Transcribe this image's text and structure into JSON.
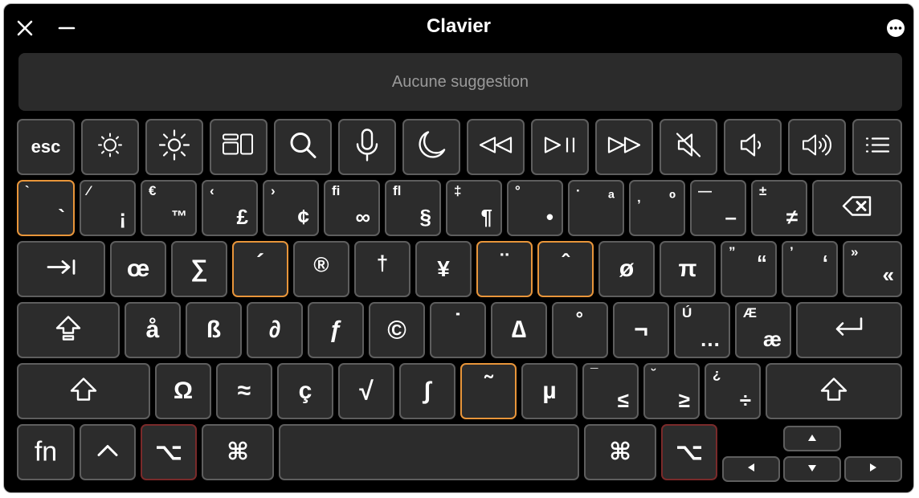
{
  "window": {
    "title": "Clavier",
    "suggestion": "Aucune suggestion"
  },
  "colors": {
    "background": "#000000",
    "key": "#2c2c2c",
    "key_border": "#5e5e5e",
    "highlight_border": "#e8953a",
    "pressed_modifier_border": "#7a2a2a"
  },
  "keys": {
    "esc": "esc",
    "bq_shift": "`",
    "bq_main": "`",
    "k1_shift": "⁄",
    "k1_main": "¡",
    "k2_shift": "€",
    "k2_main": "™",
    "k3_shift": "‹",
    "k3_main": "£",
    "k4_shift": "›",
    "k4_main": "¢",
    "k5_shift": "ﬁ",
    "k5_main": "∞",
    "k6_shift": "ﬂ",
    "k6_main": "§",
    "k7_shift": "‡",
    "k7_main": "¶",
    "k8_shift": "°",
    "k8_main": "•",
    "k9_shift": "·",
    "k9_main": "ª",
    "k0_shift": "‚",
    "k0_main": "º",
    "minus_shift": "—",
    "minus_main": "–",
    "equal_shift": "±",
    "equal_main": "≠",
    "q": "œ",
    "w": "∑",
    "e": "´",
    "r": "®",
    "t": "†",
    "y": "¥",
    "u": "¨",
    "i": "ˆ",
    "o": "ø",
    "p": "π",
    "lbr_shift": "”",
    "lbr_main": "“",
    "rbr_shift": "’",
    "rbr_main": "‘",
    "bs_shift": "»",
    "bs_main": "«",
    "a": "å",
    "s": "ß",
    "d": "∂",
    "f": "ƒ",
    "g": "©",
    "h": "˙",
    "j": "∆",
    "k": "˚",
    "l": "¬",
    "semi_shift": "Ú",
    "semi_main": "…",
    "quote_shift": "Æ",
    "quote_main": "æ",
    "z": "Ω",
    "x": "≈",
    "c": "ç",
    "v": "√",
    "b": "∫",
    "n": "˜",
    "m": "µ",
    "comma_shift": "¯",
    "comma_main": "≤",
    "period_shift": "˘",
    "period_main": "≥",
    "slash_shift": "¿",
    "slash_main": "÷",
    "fn": "fn",
    "ctrl": "^",
    "opt": "⌥",
    "cmd": "⌘"
  },
  "icons": {
    "close": "close-icon",
    "minimize": "minimize-icon",
    "more": "more-icon",
    "brightness_down": "brightness-down-icon",
    "brightness_up": "brightness-up-icon",
    "mission_control": "mission-control-icon",
    "search": "search-icon",
    "microphone": "microphone-icon",
    "moon": "moon-icon",
    "rewind": "rewind-icon",
    "play_pause": "play-pause-icon",
    "fast_forward": "fast-forward-icon",
    "mute": "mute-icon",
    "volume_down": "volume-down-icon",
    "volume_up": "volume-up-icon",
    "list": "list-icon",
    "delete": "delete-icon",
    "tab": "tab-icon",
    "caps_lock": "caps-lock-icon",
    "return": "return-icon",
    "shift": "shift-icon",
    "arrows": "arrow-icons"
  }
}
